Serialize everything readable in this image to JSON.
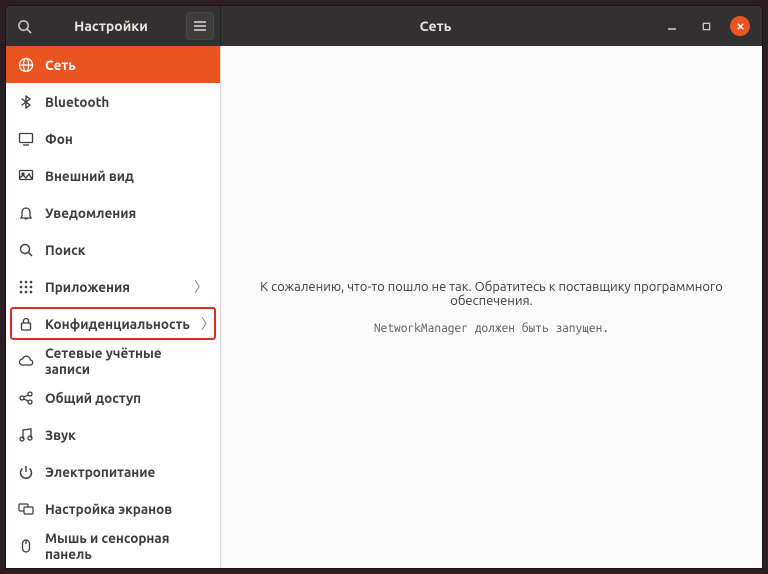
{
  "titlebar": {
    "left_title": "Настройки",
    "right_title": "Сеть"
  },
  "sidebar": {
    "items": [
      {
        "icon": "globe",
        "label": "Сеть",
        "active": true,
        "submenu": false
      },
      {
        "icon": "bluetooth",
        "label": "Bluetooth",
        "active": false,
        "submenu": false
      },
      {
        "icon": "display",
        "label": "Фон",
        "active": false,
        "submenu": false
      },
      {
        "icon": "appearance",
        "label": "Внешний вид",
        "active": false,
        "submenu": false
      },
      {
        "icon": "bell",
        "label": "Уведомления",
        "active": false,
        "submenu": false
      },
      {
        "icon": "search",
        "label": "Поиск",
        "active": false,
        "submenu": false
      },
      {
        "icon": "grid",
        "label": "Приложения",
        "active": false,
        "submenu": true
      },
      {
        "icon": "lock",
        "label": "Конфиденциальность",
        "active": false,
        "submenu": true,
        "highlighted": true
      },
      {
        "icon": "cloud",
        "label": "Сетевые учётные записи",
        "active": false,
        "submenu": false
      },
      {
        "icon": "share",
        "label": "Общий доступ",
        "active": false,
        "submenu": false
      },
      {
        "icon": "music",
        "label": "Звук",
        "active": false,
        "submenu": false
      },
      {
        "icon": "power",
        "label": "Электропитание",
        "active": false,
        "submenu": false
      },
      {
        "icon": "monitors",
        "label": "Настройка экранов",
        "active": false,
        "submenu": false
      },
      {
        "icon": "mouse",
        "label": "Мышь и сенсорная панель",
        "active": false,
        "submenu": false
      }
    ]
  },
  "content": {
    "error_main": "К сожалению, что-то пошло не так. Обратитесь к поставщику программного обеспечения.",
    "error_sub": "NetworkManager должен быть запущен."
  },
  "colors": {
    "accent": "#e95420",
    "titlebar": "#323030"
  }
}
